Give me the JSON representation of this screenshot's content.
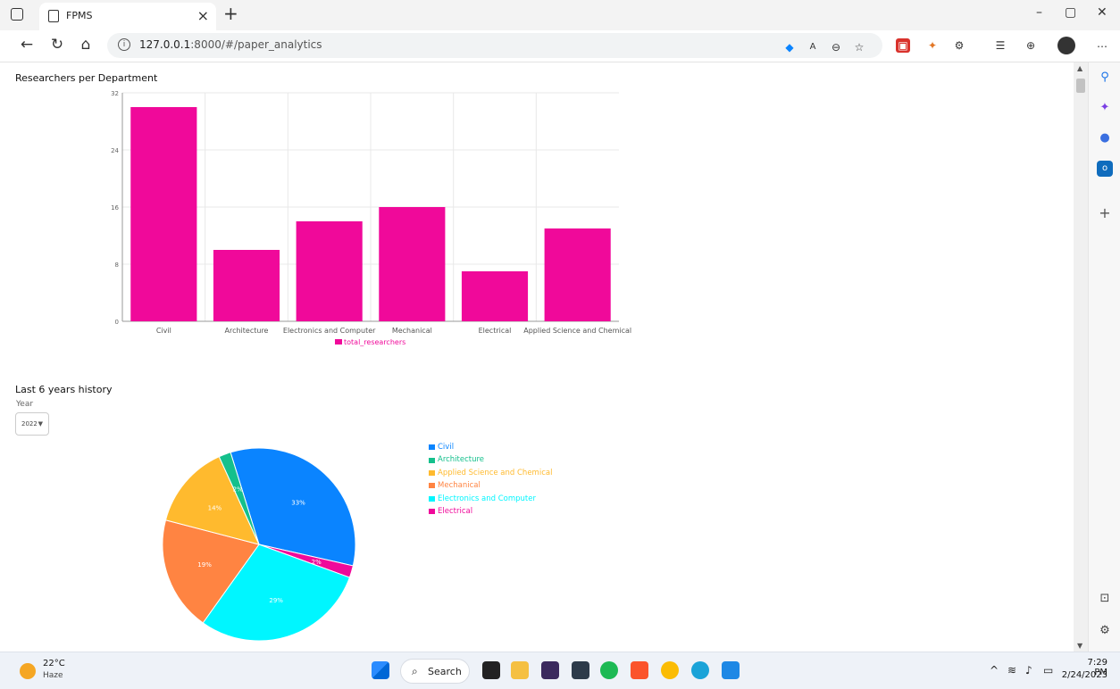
{
  "browser": {
    "tab_title": "FPMS",
    "tab_close": "×",
    "new_tab": "+",
    "url_host": "127.0.0.1",
    "url_rest": ":8000/#/paper_analytics",
    "window_controls": [
      "–",
      "▢",
      "✕"
    ],
    "nav_icons": [
      "back-icon",
      "refresh-icon",
      "home-icon"
    ],
    "more": "…"
  },
  "bar_section": {
    "title": "Researchers per Department"
  },
  "pie_section": {
    "title": "Last 6 years history",
    "year_label": "Year",
    "year_value": "2022"
  },
  "chart_data": [
    {
      "type": "bar",
      "title": "Researchers per Department",
      "categories": [
        "Civil",
        "Architecture",
        "Electronics and Computer",
        "Mechanical",
        "Electrical",
        "Applied Science and Chemical"
      ],
      "series": [
        {
          "name": "total_researchers",
          "values": [
            30,
            10,
            14,
            16,
            7,
            13
          ],
          "color": "#f0099a"
        }
      ],
      "ylim": [
        0,
        32
      ],
      "yticks": [
        0,
        8,
        16,
        24,
        32
      ],
      "grid": true,
      "legend_position": "bottom"
    },
    {
      "type": "pie",
      "title": "Last 6 years history",
      "slices": [
        {
          "label": "Civil",
          "value": 33,
          "display": "33%",
          "color": "#0a84ff"
        },
        {
          "label": "Electrical",
          "value": 2,
          "display": "2%",
          "color": "#f0099a"
        },
        {
          "label": "Electronics and Computer",
          "value": 29,
          "display": "29%",
          "color": "#00f6ff"
        },
        {
          "label": "Mechanical",
          "value": 19,
          "display": "19%",
          "color": "#ff8442"
        },
        {
          "label": "Applied Science and Chemical",
          "value": 14,
          "display": "14%",
          "color": "#ffba2e"
        },
        {
          "label": "Architecture",
          "value": 2,
          "display": "2%",
          "color": "#14c08c"
        }
      ],
      "legend": [
        "Civil",
        "Architecture",
        "Applied Science and Chemical",
        "Mechanical",
        "Electronics and Computer",
        "Electrical"
      ],
      "legend_position": "right"
    }
  ],
  "taskbar": {
    "temperature": "22°C",
    "weather": "Haze",
    "search_label": "Search",
    "time": "7:29 PM",
    "date": "2/24/2023"
  },
  "colors": {
    "bar": "#f0099a",
    "accent": "#0a84ff"
  }
}
